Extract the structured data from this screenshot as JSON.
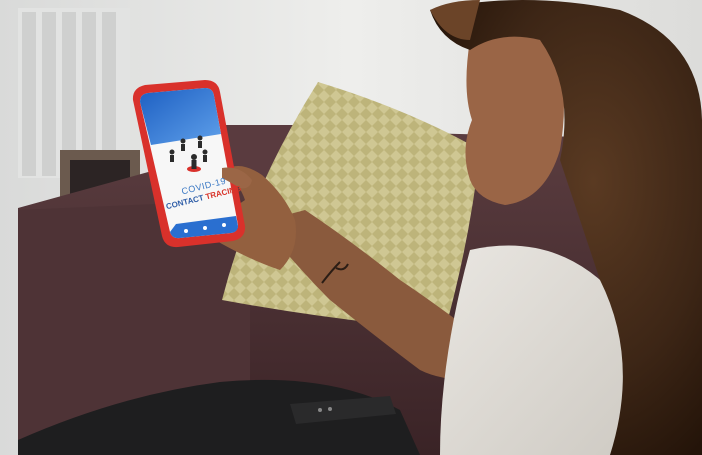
{
  "app_screen": {
    "title": "COVID-19",
    "subtitle_part1": "CONTACT",
    "subtitle_part2": "TRACING",
    "nav_icons": [
      "settings-icon",
      "home-icon",
      "profile-icon"
    ]
  },
  "colors": {
    "phone_case": "#d9312b",
    "screen_header": "#2a6fd0",
    "pillow": "#c9c08a",
    "sofa": "#4a2f33",
    "wall": "#e4e4e2"
  }
}
